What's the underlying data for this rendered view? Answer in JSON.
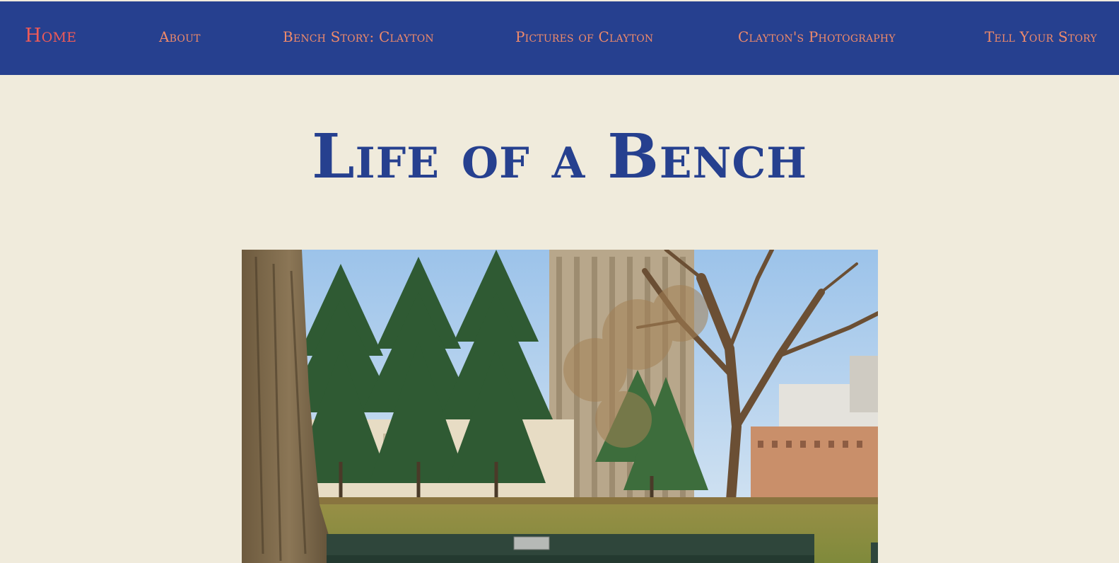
{
  "nav": {
    "home": "Home",
    "about": "About",
    "bench_story": "Bench Story: Clayton",
    "pictures": "Pictures of Clayton",
    "photography": "Clayton's Photography",
    "tell_story": "Tell Your Story"
  },
  "page": {
    "title": "Life of a Bench"
  },
  "colors": {
    "header_bg": "#26408f",
    "page_bg": "#f0ebdc",
    "nav_link": "#f08a6a",
    "nav_active": "#ee5a58",
    "title": "#26408f"
  },
  "hero": {
    "alt": "Park bench under trees with buildings in the background"
  }
}
